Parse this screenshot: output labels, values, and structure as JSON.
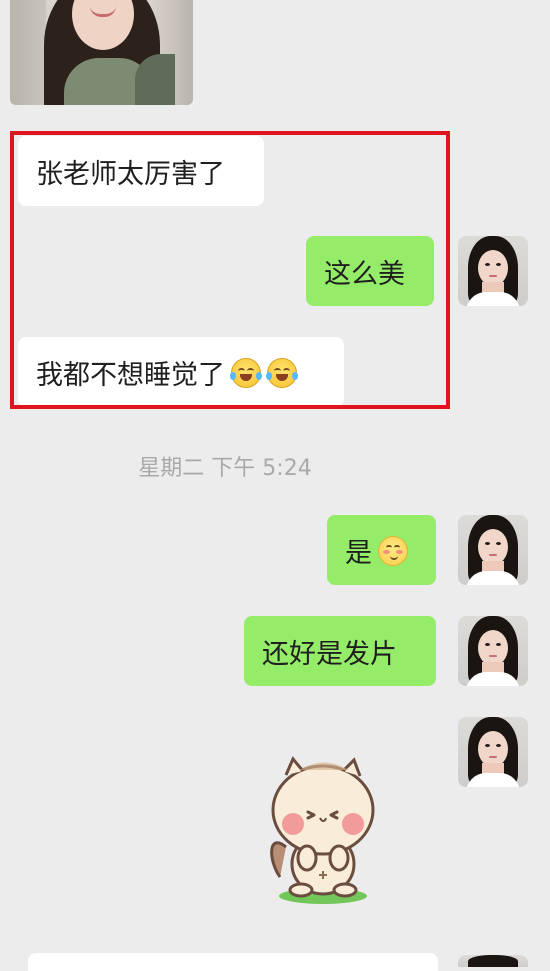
{
  "conversation": {
    "messages": [
      {
        "side": "left",
        "type": "image",
        "content_name": "woman-photo"
      },
      {
        "side": "left",
        "type": "text",
        "text": "张老师太厉害了"
      },
      {
        "side": "right",
        "type": "text",
        "text": "这么美"
      },
      {
        "side": "left",
        "type": "text",
        "text": "我都不想睡觉了",
        "emoji": [
          "laughing-tears-emoji",
          "laughing-tears-emoji"
        ]
      },
      {
        "side": "right",
        "type": "text",
        "text": "是",
        "emoji": [
          "shy-face-emoji"
        ]
      },
      {
        "side": "right",
        "type": "text",
        "text": "还好是发片"
      },
      {
        "side": "right",
        "type": "sticker",
        "content_name": "cartoon-cat-sticker"
      }
    ],
    "timestamp": "星期二 下午 5:24",
    "highlight_color": "#e0141e"
  },
  "theme": {
    "background": "#ececec",
    "incoming_bubble": "#ffffff",
    "outgoing_bubble": "#95ec69",
    "timestamp_color": "#a9a9a9",
    "text_color": "#1f1f1f"
  }
}
